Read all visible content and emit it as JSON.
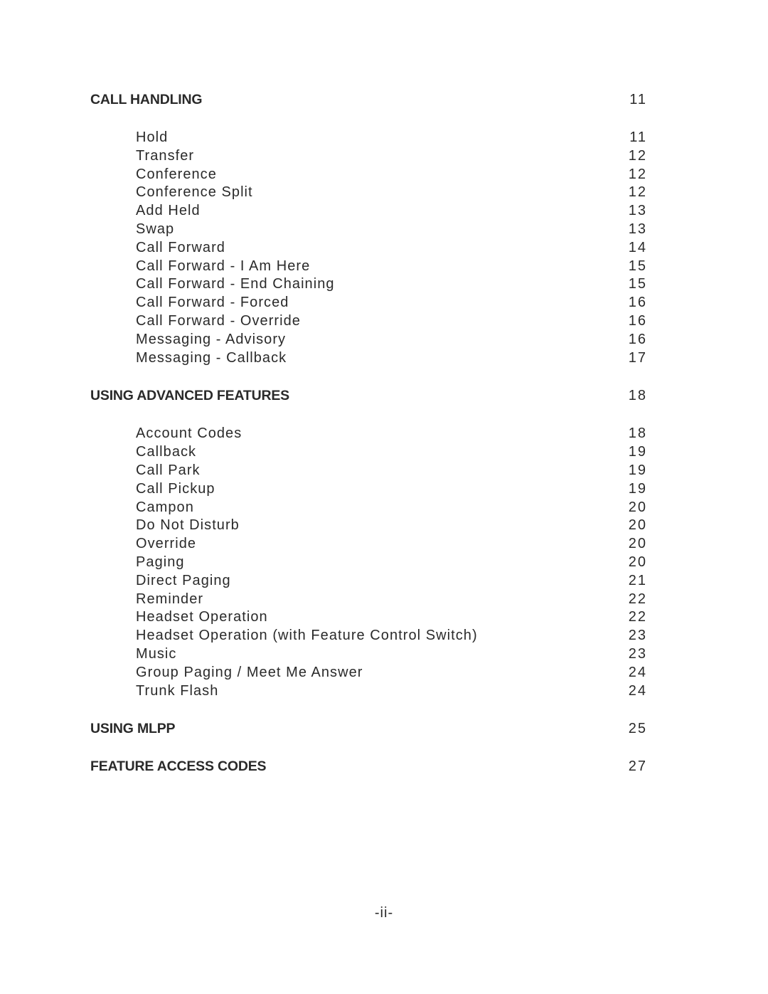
{
  "sections": [
    {
      "title": "CALL HANDLING",
      "page": "11",
      "items": [
        {
          "label": "Hold",
          "page": "11"
        },
        {
          "label": "Transfer",
          "page": "12"
        },
        {
          "label": "Conference",
          "page": "12"
        },
        {
          "label": "Conference Split",
          "page": "12"
        },
        {
          "label": "Add Held",
          "page": "13"
        },
        {
          "label": "Swap",
          "page": "13"
        },
        {
          "label": "Call Forward",
          "page": "14"
        },
        {
          "label": "Call Forward - I Am Here",
          "page": "15"
        },
        {
          "label": "Call Forward - End Chaining",
          "page": "15"
        },
        {
          "label": "Call Forward - Forced",
          "page": "16"
        },
        {
          "label": "Call Forward - Override",
          "page": "16"
        },
        {
          "label": "Messaging - Advisory",
          "page": "16"
        },
        {
          "label": "Messaging - Callback",
          "page": "17"
        }
      ]
    },
    {
      "title": "USING ADVANCED FEATURES",
      "page": "18",
      "items": [
        {
          "label": "Account Codes",
          "page": "18"
        },
        {
          "label": "Callback",
          "page": "19"
        },
        {
          "label": "Call Park",
          "page": "19"
        },
        {
          "label": "Call Pickup",
          "page": "19"
        },
        {
          "label": "Campon",
          "page": "20"
        },
        {
          "label": "Do Not Disturb",
          "page": "20"
        },
        {
          "label": "Override",
          "page": "20"
        },
        {
          "label": "Paging",
          "page": "20"
        },
        {
          "label": "Direct Paging",
          "page": "21"
        },
        {
          "label": "Reminder",
          "page": "22"
        },
        {
          "label": "Headset Operation",
          "page": "22"
        },
        {
          "label": "Headset Operation (with Feature Control Switch)",
          "page": "23"
        },
        {
          "label": "Music",
          "page": "23"
        },
        {
          "label": "Group Paging / Meet Me Answer",
          "page": "24"
        },
        {
          "label": "Trunk Flash",
          "page": "24"
        }
      ]
    },
    {
      "title": "USING MLPP",
      "page": "25",
      "items": []
    },
    {
      "title": "FEATURE ACCESS CODES",
      "page": "27",
      "items": []
    }
  ],
  "footer": {
    "page_label": "-ii-"
  }
}
